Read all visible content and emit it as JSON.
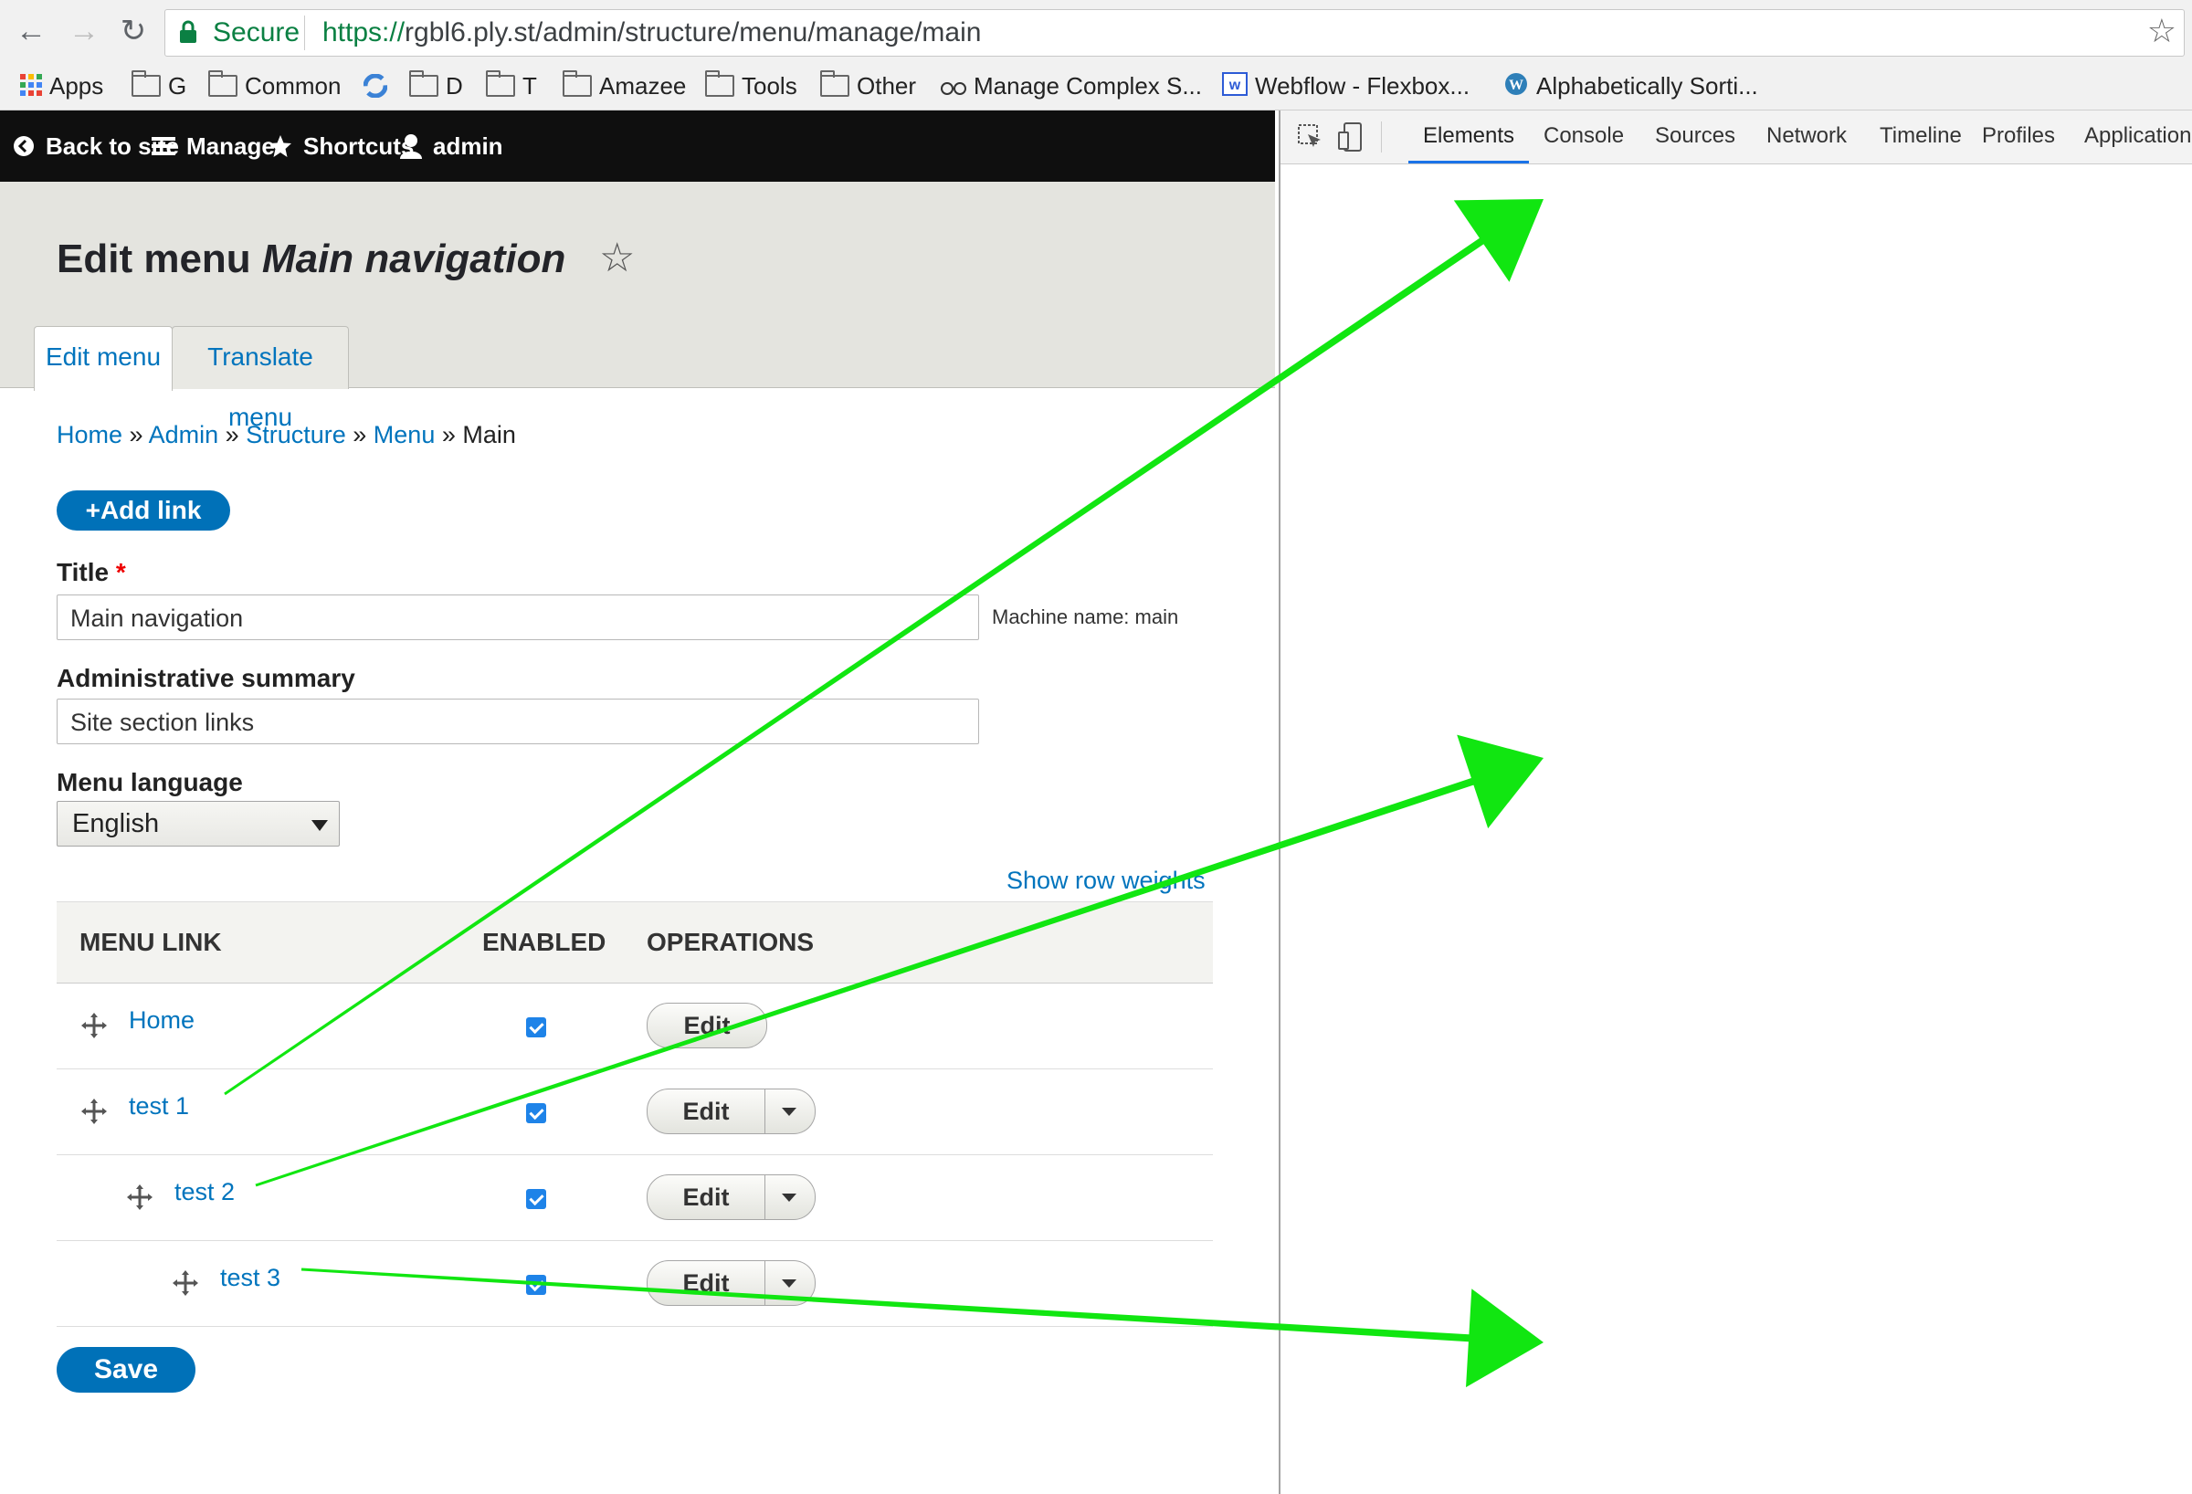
{
  "browser": {
    "secure_label": "Secure",
    "url_scheme": "https://",
    "url_rest": "rgbl6.ply.st/admin/structure/menu/manage/main",
    "bookmarks": [
      "Apps",
      "G",
      "Common",
      "D",
      "T",
      "Amazee",
      "Tools",
      "Other",
      "Manage Complex S...",
      "Webflow - Flexbox...",
      "Alphabetically Sorti..."
    ]
  },
  "toolbar": {
    "back": "Back to site",
    "manage": "Manage",
    "shortcuts": "Shortcuts",
    "user": "admin"
  },
  "page": {
    "title_prefix": "Edit menu",
    "title_menu": "Main navigation",
    "tabs": [
      "Edit menu",
      "Translate menu"
    ],
    "breadcrumb": [
      "Home",
      "Admin",
      "Structure",
      "Menu",
      "Main"
    ],
    "breadcrumb_sep": "»",
    "add_link": "+Add link",
    "title_label": "Title",
    "required_mark": "*",
    "title_value": "Main navigation",
    "machine_name": "Machine name: main",
    "summary_label": "Administrative summary",
    "summary_value": "Site section links",
    "lang_label": "Menu language",
    "lang_value": "English",
    "show_row_weights": "Show row weights",
    "table_headers": [
      "MENU LINK",
      "ENABLED",
      "OPERATIONS"
    ],
    "rows": [
      {
        "label": "Home",
        "enabled": true,
        "edit": "Edit"
      },
      {
        "label": "test 1",
        "enabled": true,
        "edit": "Edit"
      },
      {
        "label": "test 2",
        "enabled": true,
        "edit": "Edit"
      },
      {
        "label": "test 3",
        "enabled": true,
        "edit": "Edit"
      }
    ],
    "save": "Save"
  },
  "devtools": {
    "tabs": [
      "Elements",
      "Console",
      "Sources",
      "Network",
      "Timeline",
      "Profiles",
      "Application"
    ]
  },
  "colors": {
    "arrow": "#11e611",
    "link": "#0074bd",
    "primary_button": "#0071b8",
    "toolbar": "#0f0f0f"
  }
}
